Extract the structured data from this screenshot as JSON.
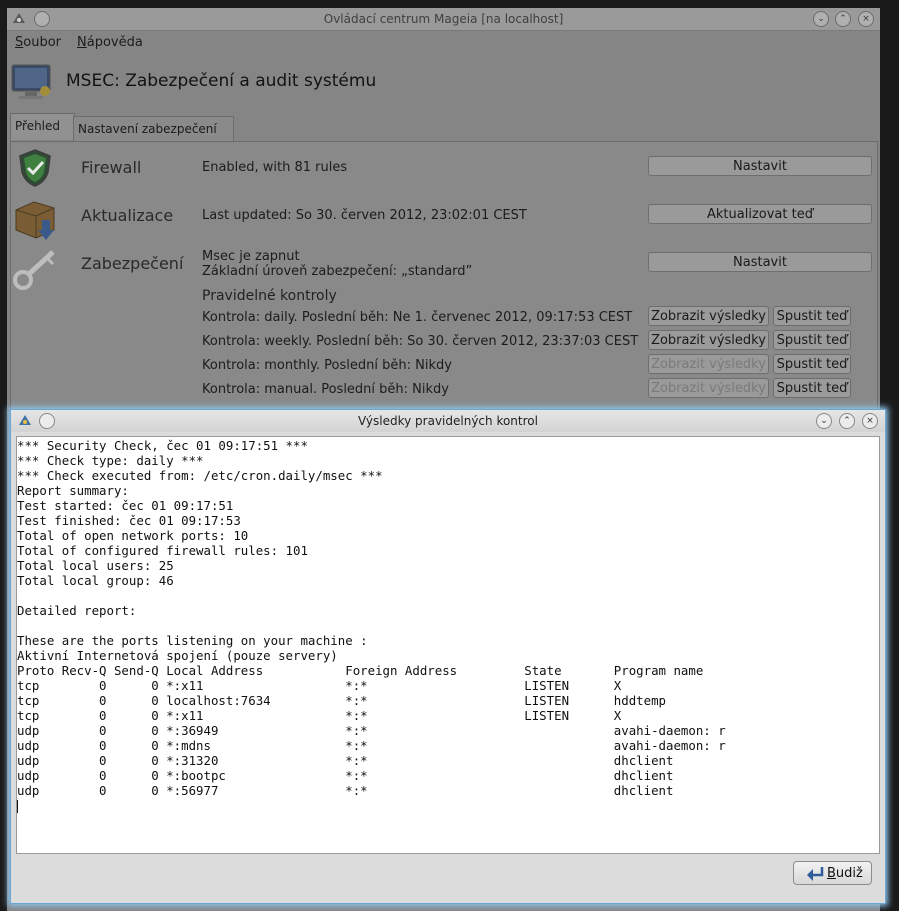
{
  "main_window": {
    "title": "Ovládací centrum Mageia  [na localhost]",
    "menu": [
      "Soubor",
      "Nápověda"
    ],
    "app_title": "MSEC: Zabezpečení a audit systému",
    "tabs": [
      "Přehled",
      "Nastavení zabezpečení"
    ],
    "firewall": {
      "label": "Firewall",
      "status": "Enabled, with 81 rules",
      "button": "Nastavit"
    },
    "updates": {
      "label": "Aktualizace",
      "status": "Last updated: So 30. červen 2012, 23:02:01 CEST",
      "button": "Aktualizovat teď"
    },
    "security": {
      "label": "Zabezpečení",
      "status_line1": "Msec je zapnut",
      "status_line2": "Základní úroveň zabezpečení: „standard”",
      "button": "Nastavit"
    },
    "periodic": {
      "title": "Pravidelné kontroly",
      "checks": [
        {
          "text": "Kontrola: daily. Poslední běh: Ne 1. červenec 2012, 09:17:53 CEST",
          "show": "Zobrazit výsledky",
          "run": "Spustit teď",
          "show_enabled": true
        },
        {
          "text": "Kontrola: weekly. Poslední běh: So 30. červen 2012, 23:37:03 CEST",
          "show": "Zobrazit výsledky",
          "run": "Spustit teď",
          "show_enabled": true
        },
        {
          "text": "Kontrola: monthly. Poslední běh: Nikdy",
          "show": "Zobrazit výsledky",
          "run": "Spustit teď",
          "show_enabled": false
        },
        {
          "text": "Kontrola: manual. Poslední běh: Nikdy",
          "show": "Zobrazit výsledky",
          "run": "Spustit teď",
          "show_enabled": false
        }
      ]
    }
  },
  "dialog": {
    "title": "Výsledky pravidelných kontrol",
    "report_lines": [
      "*** Security Check, čec 01 09:17:51 ***",
      "*** Check type: daily ***",
      "*** Check executed from: /etc/cron.daily/msec ***",
      "Report summary:",
      "Test started: čec 01 09:17:51",
      "Test finished: čec 01 09:17:53",
      "Total of open network ports: 10",
      "Total of configured firewall rules: 101",
      "Total local users: 25",
      "Total local group: 46",
      "",
      "Detailed report:",
      "",
      "These are the ports listening on your machine :",
      "Aktivní Internetová spojení (pouze servery)",
      "Proto Recv-Q Send-Q Local Address           Foreign Address         State       Program name",
      "tcp        0      0 *:x11                   *:*                     LISTEN      X",
      "tcp        0      0 localhost:7634          *:*                     LISTEN      hddtemp",
      "tcp        0      0 *:x11                   *:*                     LISTEN      X",
      "udp        0      0 *:36949                 *:*                                 avahi-daemon: r",
      "udp        0      0 *:mdns                  *:*                                 avahi-daemon: r",
      "udp        0      0 *:31320                 *:*                                 dhclient",
      "udp        0      0 *:bootpc                *:*                                 dhclient",
      "udp        0      0 *:56977                 *:*                                 dhclient"
    ],
    "ok_button": "Budiž"
  }
}
